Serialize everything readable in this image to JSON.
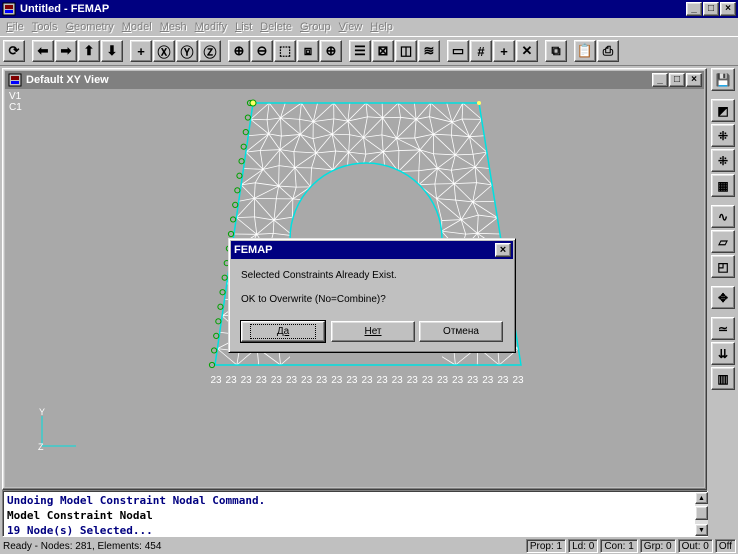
{
  "app": {
    "title": "Untitled - FEMAP",
    "window_buttons": [
      "_",
      "□",
      "×"
    ]
  },
  "menu": [
    {
      "label": "File"
    },
    {
      "label": "Tools"
    },
    {
      "label": "Geometry"
    },
    {
      "label": "Model"
    },
    {
      "label": "Mesh"
    },
    {
      "label": "Modify"
    },
    {
      "label": "List"
    },
    {
      "label": "Delete"
    },
    {
      "label": "Group"
    },
    {
      "label": "View"
    },
    {
      "label": "Help"
    }
  ],
  "toolbar_icons": [
    "rotate-view-icon",
    "arrow-left-icon",
    "arrow-right-icon",
    "arrow-up-icon",
    "arrow-down-icon",
    "center-icon",
    "rotate-x-icon",
    "rotate-y-icon",
    "rotate-z-icon",
    "zoom-in-icon",
    "zoom-out-icon",
    "zoom-box-icon",
    "autoscale-icon",
    "pan-icon",
    "list-icon",
    "select-icon",
    "box-icon",
    "layers-icon",
    "window-icon",
    "grid-icon",
    "plus-icon",
    "cross-icon",
    "copy-icon",
    "paste-icon",
    "print-icon"
  ],
  "view": {
    "title": "Default XY View",
    "label_v": "V1",
    "label_c": "C1",
    "node_label": "23",
    "axis_y": "Y",
    "axis_x": "Z"
  },
  "dialog": {
    "title": "FEMAP",
    "close": "×",
    "message1": "Selected Constraints Already Exist.",
    "message2": "OK to Overwrite (No=Combine)?",
    "yes": "Да",
    "no": "Нет",
    "cancel": "Отмена"
  },
  "messages": [
    {
      "text": "Undoing Model Constraint Nodal Command.",
      "color": "blue"
    },
    {
      "text": "Model Constraint Nodal",
      "color": "black"
    },
    {
      "text": "19 Node(s) Selected...",
      "color": "blue"
    }
  ],
  "status": {
    "main": "Ready - Nodes: 281,  Elements: 454",
    "prop": "Prop: 1",
    "ld": "Ld: 0",
    "con": "Con: 1",
    "grp": "Grp: 0",
    "out": "Out: 0",
    "off": "Off"
  },
  "colors": {
    "titlebar": "#000080",
    "canvas": "#a9a9a9",
    "mesh": "#ffffff",
    "edge": "#00e0e0",
    "node": "#ffff66",
    "constraint": "#00a000"
  }
}
